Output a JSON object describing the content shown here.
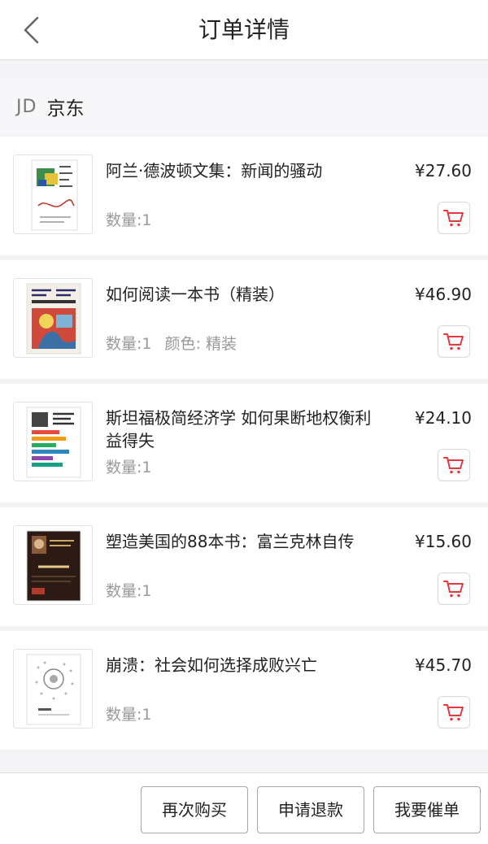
{
  "header": {
    "title": "订单详情"
  },
  "shop": {
    "logo": "JD",
    "name": "京东"
  },
  "items": [
    {
      "name": "阿兰·德波顿文集：新闻的骚动",
      "price": "¥27.60",
      "meta": [
        "数量:1"
      ]
    },
    {
      "name": "如何阅读一本书（精装）",
      "price": "¥46.90",
      "meta": [
        "数量:1",
        "颜色: 精装"
      ]
    },
    {
      "name": "斯坦福极简经济学 如何果断地权衡利益得失",
      "price": "¥24.10",
      "meta": [
        "数量:1"
      ]
    },
    {
      "name": "塑造美国的88本书：富兰克林自传",
      "price": "¥15.60",
      "meta": [
        "数量:1"
      ]
    },
    {
      "name": "崩溃：社会如何选择成败兴亡",
      "price": "¥45.70",
      "meta": [
        "数量:1"
      ]
    }
  ],
  "footer": {
    "buy_again": "再次购买",
    "refund": "申请退款",
    "urge": "我要催单"
  },
  "icons": {
    "back": "chevron-left-icon",
    "cart": "cart-icon"
  },
  "colors": {
    "accent": "#e4393c",
    "background": "#f4f3f6"
  }
}
